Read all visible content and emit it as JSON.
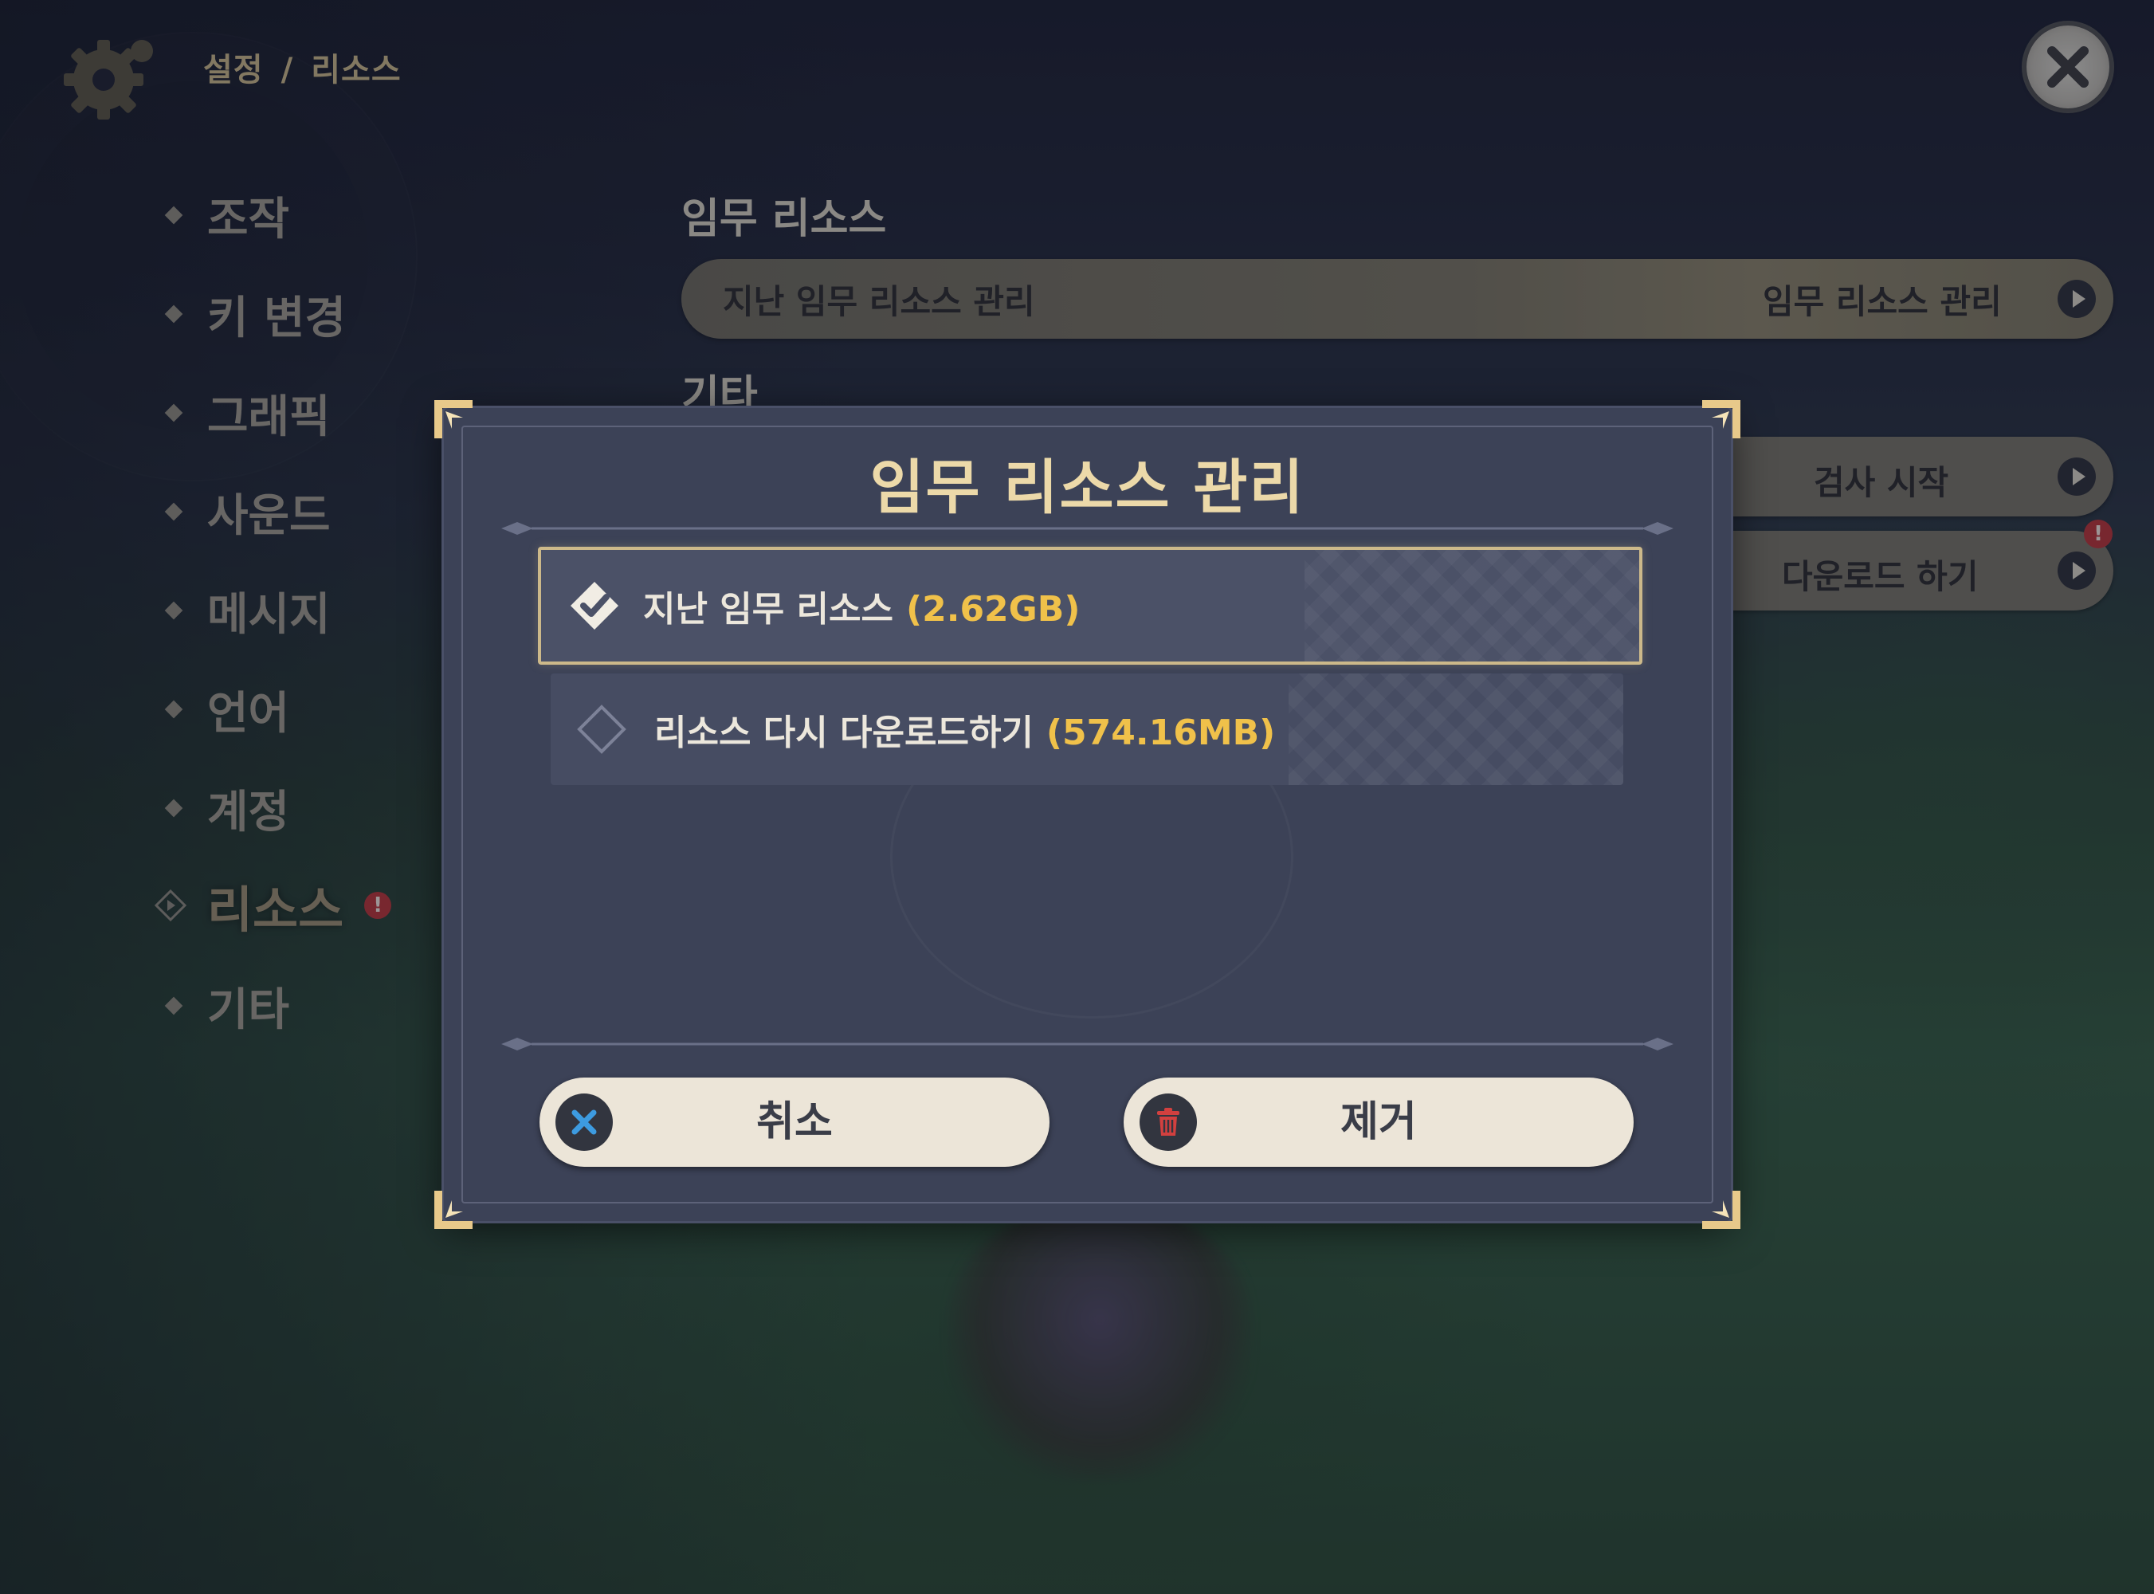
{
  "header": {
    "breadcrumb_root": "설정",
    "breadcrumb_sep": "/",
    "breadcrumb_current": "리소스"
  },
  "sidebar": {
    "items": [
      {
        "label": "조작"
      },
      {
        "label": "키 변경"
      },
      {
        "label": "그래픽"
      },
      {
        "label": "사운드"
      },
      {
        "label": "메시지"
      },
      {
        "label": "언어"
      },
      {
        "label": "계정"
      },
      {
        "label": "리소스",
        "active": true,
        "alert": "!"
      },
      {
        "label": "기타"
      }
    ]
  },
  "main": {
    "quest_section_title": "임무 리소스",
    "quest_row_label": "지난 임무 리소스 관리",
    "quest_row_action": "임무 리소스 관리",
    "other_section_title": "기타",
    "check_action": "검사 시작",
    "download_action": "다운로드 하기",
    "download_alert": "!"
  },
  "dialog": {
    "title": "임무 리소스 관리",
    "options": [
      {
        "label": "지난 임무 리소스",
        "size": "(2.62GB)",
        "selected": true
      },
      {
        "label": "리소스 다시 다운로드하기",
        "size": "(574.16MB)",
        "selected": false
      }
    ],
    "cancel_label": "취소",
    "remove_label": "제거"
  },
  "colors": {
    "accent_gold": "#ecd9a9",
    "size_yellow": "#f0c14a",
    "alert_red": "#b8343a",
    "cancel_icon_blue": "#3d9be0",
    "remove_icon_red": "#d2403f"
  },
  "icons": [
    "gear-icon",
    "close-icon",
    "diamond-bullet-icon",
    "active-diamond-icon",
    "alert-icon",
    "arrow-right-icon",
    "checked-diamond-icon",
    "empty-diamond-icon",
    "x-icon",
    "trash-icon"
  ]
}
